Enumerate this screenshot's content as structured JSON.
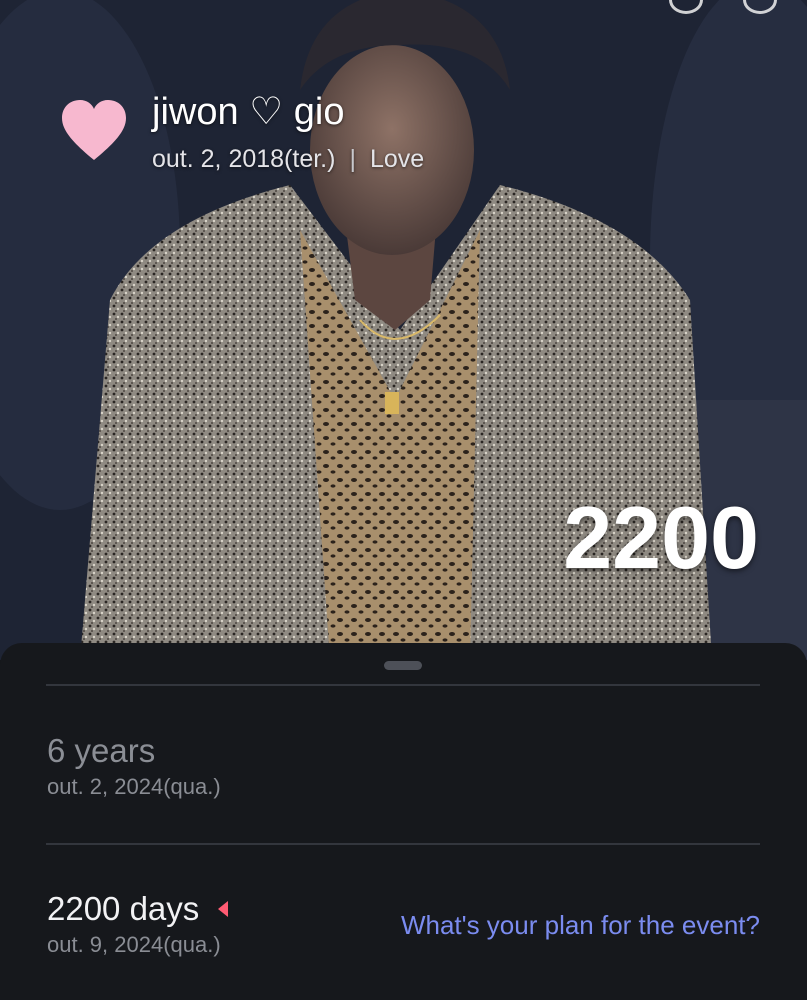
{
  "header": {
    "title": "jiwon ♡ gio",
    "start_date": "out. 2, 2018(ter.)",
    "separator": "|",
    "category": "Love",
    "day_count": "2200",
    "icon": "heart-icon"
  },
  "events": [
    {
      "title": "6 years",
      "date": "out. 2, 2024(qua.)"
    },
    {
      "title": "2200 days",
      "date": "out. 9, 2024(qua.)",
      "plan_prompt": "What's your plan for the event?",
      "marker_icon": "triangle-left-icon"
    }
  ],
  "colors": {
    "heart": "#f7b8cf",
    "sheet_background": "#16181c",
    "link": "#7b8cf0",
    "marker": "#ff5b73"
  }
}
